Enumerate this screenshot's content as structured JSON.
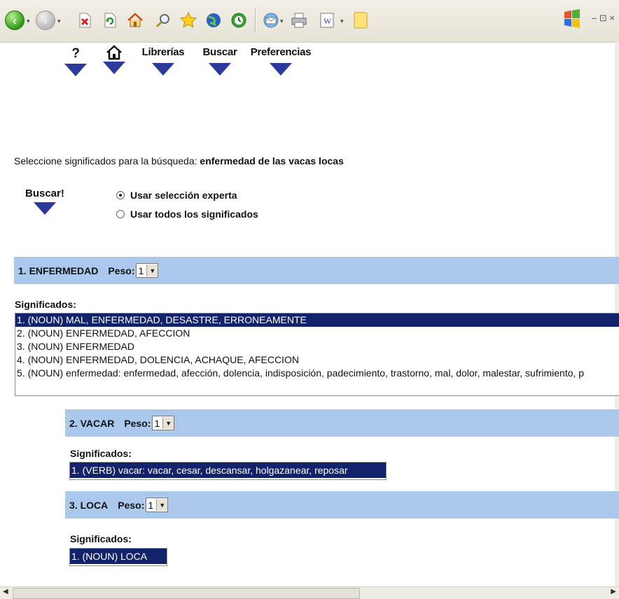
{
  "browser": {
    "toolbar_icons": [
      "back-icon",
      "forward-icon",
      "stop-icon",
      "refresh-icon",
      "home-icon",
      "search-icon",
      "favorites-icon",
      "media-icon",
      "history-icon",
      "mail-icon",
      "print-icon",
      "edit-icon",
      "note-icon"
    ],
    "window_controls": "– ⊡ ×"
  },
  "nav": {
    "help": "?",
    "home": "⌂",
    "librerias": "Librerías",
    "buscar": "Buscar",
    "preferencias": "Preferencias"
  },
  "prompt": {
    "label": "Seleccione significados para la búsqueda:",
    "query": "enfermedad de las vacas locas"
  },
  "search": {
    "button_label": "Buscar!",
    "options": [
      {
        "label": "Usar selección experta",
        "checked": true
      },
      {
        "label": "Usar todos los significados",
        "checked": false
      }
    ]
  },
  "terms": [
    {
      "title": "1. ENFERMEDAD",
      "peso_label": "Peso:",
      "peso_value": "1",
      "significados_label": "Significados:",
      "meanings": [
        "1. (NOUN) MAL, ENFERMEDAD, DESASTRE, ERRONEAMENTE",
        "2. (NOUN) ENFERMEDAD, AFECCION",
        "3. (NOUN) ENFERMEDAD",
        "4. (NOUN) ENFERMEDAD, DOLENCIA, ACHAQUE, AFECCION",
        "5. (NOUN) enfermedad: enfermedad, afección, dolencia, indisposición, padecimiento, trastorno, mal, dolor, malestar, sufrimiento, p"
      ],
      "selected_index": 0
    },
    {
      "title": "2. VACAR",
      "peso_label": "Peso:",
      "peso_value": "1",
      "significados_label": "Significados:",
      "meanings": [
        "1. (VERB) vacar: vacar, cesar, descansar, holgazanear, reposar"
      ],
      "selected_index": 0
    },
    {
      "title": "3. LOCA",
      "peso_label": "Peso:",
      "peso_value": "1",
      "significados_label": "Significados:",
      "meanings": [
        "1. (NOUN) LOCA"
      ],
      "selected_index": 0
    }
  ],
  "colors": {
    "term_bar": "#a9c8ec",
    "selected_option": "#12236b",
    "nav_arrow": "#2b3a9b"
  }
}
